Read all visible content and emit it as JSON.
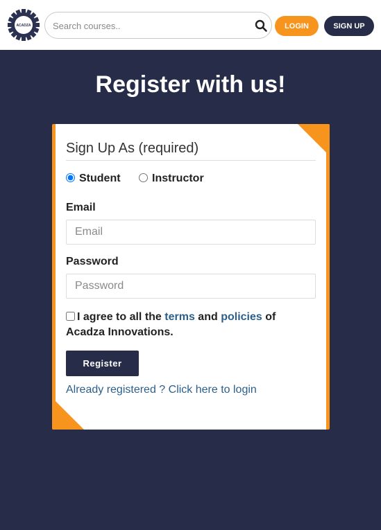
{
  "header": {
    "logo_text": "ACADZA",
    "search_placeholder": "Search courses..",
    "login_label": "LOGIN",
    "signup_label": "SIGN UP"
  },
  "page": {
    "title": "Register with us!"
  },
  "form": {
    "legend": "Sign Up As (required)",
    "roles": [
      {
        "label": "Student",
        "selected": true
      },
      {
        "label": "Instructor",
        "selected": false
      }
    ],
    "email_label": "Email",
    "email_placeholder": "Email",
    "password_label": "Password",
    "password_placeholder": "Password",
    "agree_prefix": "I agree to all the",
    "terms_link": "terms",
    "agree_and": "and",
    "policies_link": "policies",
    "agree_of": "of",
    "company": "Acadza Innovations.",
    "register_label": "Register",
    "login_link": "Already registered ? Click here to login"
  },
  "colors": {
    "navy": "#272d49",
    "accent_orange": "#f7941d",
    "link_blue": "#2b5f8a"
  },
  "icons": [
    "gear-logo-icon",
    "search-icon"
  ]
}
